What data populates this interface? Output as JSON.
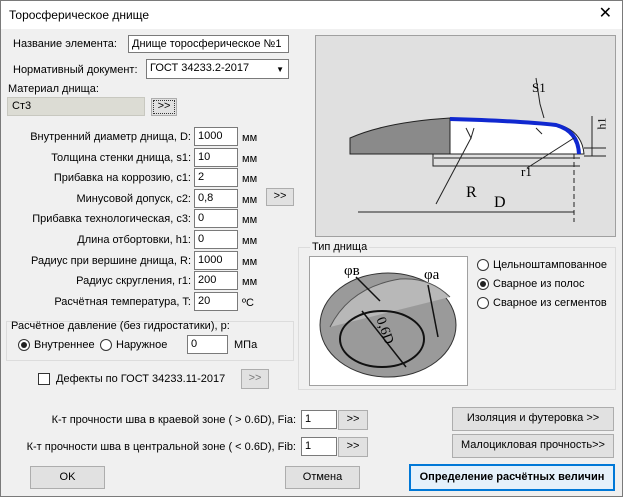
{
  "window": {
    "title": "Торосферическое днище"
  },
  "element_name": {
    "label": "Название элемента:",
    "value": "Днище торосферическое №1"
  },
  "norm_doc": {
    "label": "Нормативный документ:",
    "value": "ГОСТ 34233.2-2017"
  },
  "material": {
    "label": "Материал днища:",
    "value": "Ст3",
    "button": ">>"
  },
  "params": [
    {
      "label": "Внутренний диаметр днища, D:",
      "value": "1000",
      "unit": "мм"
    },
    {
      "label": "Толщина стенки днища, s1:",
      "value": "10",
      "unit": "мм"
    },
    {
      "label": "Прибавка на коррозию, c1:",
      "value": "2",
      "unit": "мм"
    },
    {
      "label": "Минусовой допуск, c2:",
      "value": "0,8",
      "unit": "мм"
    },
    {
      "label": "Прибавка технологическая, c3:",
      "value": "0",
      "unit": "мм"
    },
    {
      "label": "Длина отбортовки, h1:",
      "value": "0",
      "unit": "мм"
    },
    {
      "label": "Радиус при вершине днища, R:",
      "value": "1000",
      "unit": "мм"
    },
    {
      "label": "Радиус скругления, r1:",
      "value": "200",
      "unit": "мм"
    },
    {
      "label": "Расчётная температура, T:",
      "value": "20",
      "unit": "ºС"
    }
  ],
  "tolerance_button": ">>",
  "pressure": {
    "label": "Расчётное давление (без гидростатики), p:",
    "internal": "Внутреннее",
    "external": "Наружное",
    "value": "0",
    "unit": "МПа"
  },
  "defects": {
    "label": "Дефекты по ГОСТ 34233.11-2017",
    "button": ">>"
  },
  "bottom_type": {
    "title": "Тип днища",
    "options": [
      "Цельноштампованное",
      "Сварное из полос",
      "Сварное из сегментов"
    ],
    "selected": 1
  },
  "diagram_labels": {
    "s1": "S1",
    "h1": "h1",
    "r1": "r1",
    "R": "R",
    "D": "D",
    "phi_b": "φв",
    "phi_a": "φа",
    "d06": "0,6D"
  },
  "fia": {
    "label": "К-т прочности шва в краевой зоне  ( > 0.6D), Fia:",
    "value": "1",
    "button": ">>"
  },
  "fib": {
    "label": "К-т прочности шва в центральной зоне ( < 0.6D), Fib:",
    "value": "1",
    "button": ">>"
  },
  "buttons": {
    "insulation": "Изоляция и футеровка >>",
    "low_cycle": "Малоцикловая прочность>>",
    "ok": "OK",
    "cancel": "Отмена",
    "define": "Определение расчётных величин"
  }
}
